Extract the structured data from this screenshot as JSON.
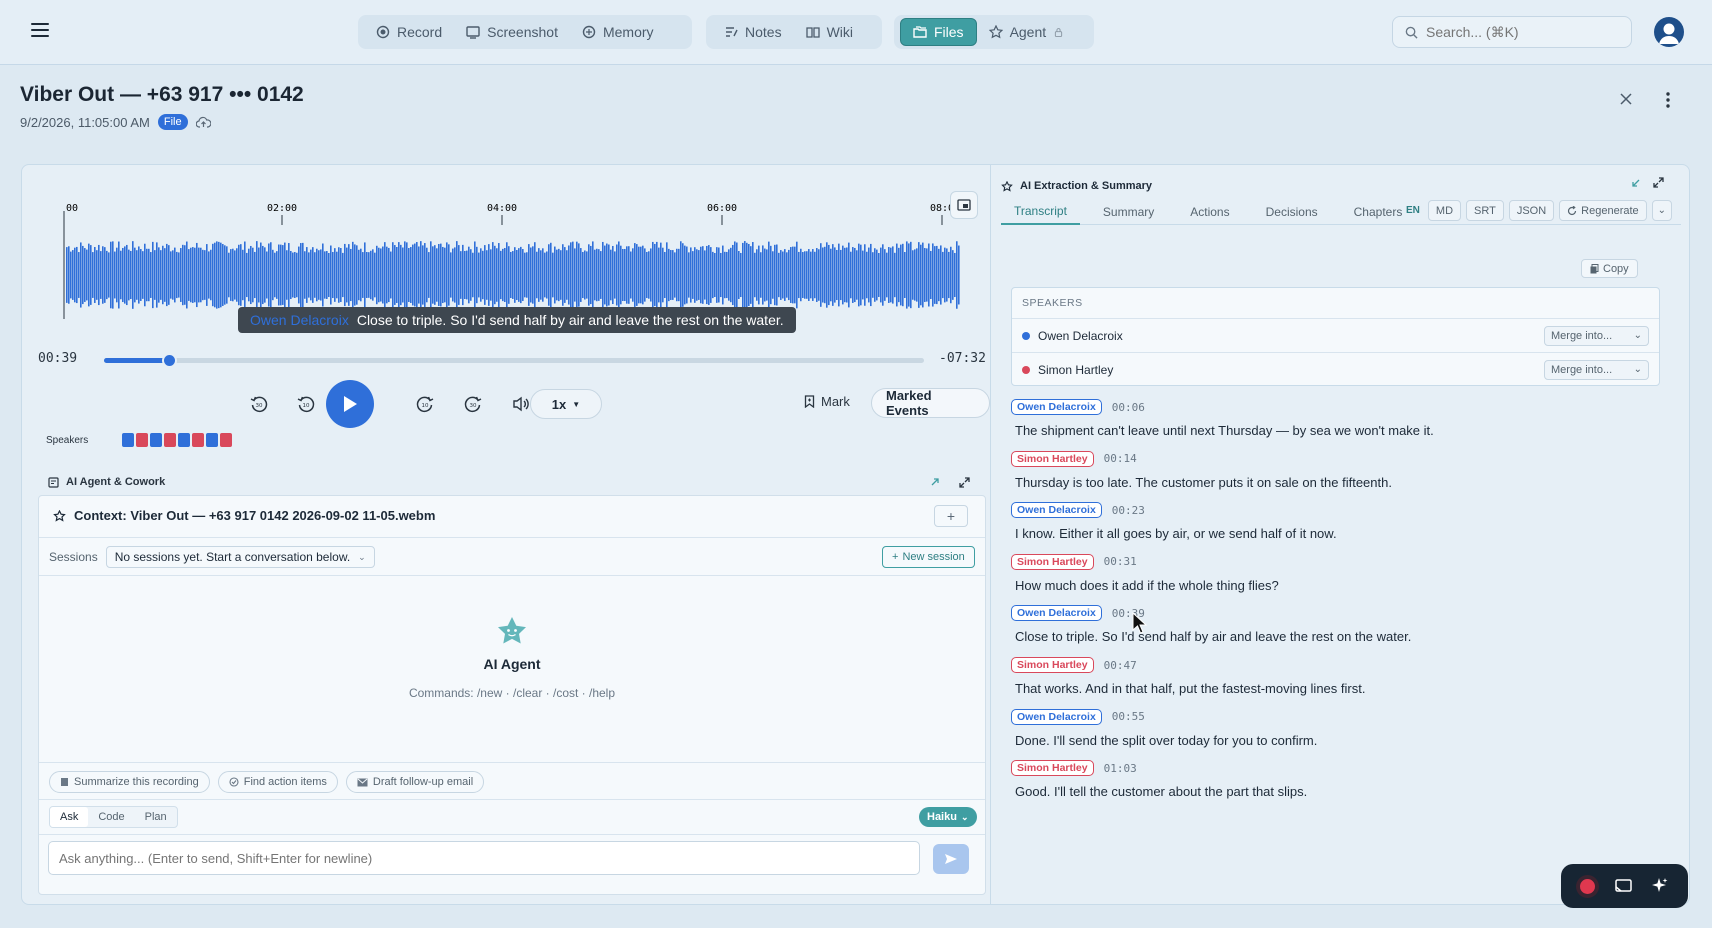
{
  "nav": {
    "groups": [
      [
        {
          "label": "Record",
          "icon": "record-icon"
        },
        {
          "label": "Screenshot",
          "icon": "screenshot-icon"
        },
        {
          "label": "Memory",
          "icon": "memory-icon"
        }
      ],
      [
        {
          "label": "Notes",
          "icon": "notes-icon"
        },
        {
          "label": "Wiki",
          "icon": "wiki-icon"
        }
      ],
      [
        {
          "label": "Files",
          "icon": "files-icon",
          "active": true
        },
        {
          "label": "Agent",
          "icon": "agent-icon"
        }
      ]
    ],
    "search_placeholder": "Search... (⌘K)"
  },
  "header": {
    "title": "Viber Out — +63 917 ••• 0142",
    "datetime": "9/2/2026, 11:05:00 AM",
    "badge": "File"
  },
  "player": {
    "ticks": [
      "00",
      "02:00",
      "04:00",
      "06:00",
      "08:0"
    ],
    "tooltip_speaker": "Owen Delacroix",
    "tooltip_text": "Close to triple. So I'd send half by air and leave the rest on the water.",
    "elapsed": "00:39",
    "remaining": "-07:32",
    "progress": 0.0794,
    "speed": "1x",
    "mark_label": "Mark",
    "marked_events_label": "Marked Events",
    "speakers_label": "Speakers",
    "speaker_squares": [
      "#2f6fd9",
      "#d9485b",
      "#2f6fd9",
      "#d9485b",
      "#2f6fd9",
      "#d9485b",
      "#2f6fd9",
      "#d9485b"
    ],
    "waveform_color": "#2f6fd9"
  },
  "agent": {
    "header": "AI Agent & Cowork",
    "context": "Context: Viber Out — +63 917 0142 2026-09-02 11-05.webm",
    "plus": "+",
    "sessions_label": "Sessions",
    "sessions_value": "No sessions yet. Start a conversation below.",
    "new_session": "New session",
    "name": "AI Agent",
    "commands": "Commands: /new · /clear · /cost · /help",
    "chips": [
      "Summarize this recording",
      "Find action items",
      "Draft follow-up email"
    ],
    "modes": [
      "Ask",
      "Code",
      "Plan"
    ],
    "active_mode": "Ask",
    "model": "Haiku",
    "input_placeholder": "Ask anything... (Enter to send, Shift+Enter for newline)"
  },
  "extraction": {
    "title": "AI Extraction & Summary",
    "tabs": [
      "Transcript",
      "Summary",
      "Actions",
      "Decisions",
      "Chapters"
    ],
    "active_tab": "Transcript",
    "lang": "EN",
    "formats": [
      "MD",
      "SRT",
      "JSON"
    ],
    "regenerate": "Regenerate",
    "copy": "Copy",
    "speakers_heading": "SPEAKERS",
    "speakers": [
      {
        "name": "Owen Delacroix",
        "color": "#2f6fd9",
        "merge": "Merge into..."
      },
      {
        "name": "Simon Hartley",
        "color": "#d9485b",
        "merge": "Merge into..."
      }
    ],
    "segments": [
      {
        "speaker": "Owen Delacroix",
        "time": "00:06",
        "text": "The shipment can't leave until next Thursday — by sea we won't make it."
      },
      {
        "speaker": "Simon Hartley",
        "time": "00:14",
        "text": "Thursday is too late. The customer puts it on sale on the fifteenth."
      },
      {
        "speaker": "Owen Delacroix",
        "time": "00:23",
        "text": "I know. Either it all goes by air, or we send half of it now."
      },
      {
        "speaker": "Simon Hartley",
        "time": "00:31",
        "text": "How much does it add if the whole thing flies?"
      },
      {
        "speaker": "Owen Delacroix",
        "time": "00:39",
        "text": "Close to triple. So I'd send half by air and leave the rest on the water."
      },
      {
        "speaker": "Simon Hartley",
        "time": "00:47",
        "text": "That works. And in that half, put the fastest-moving lines first."
      },
      {
        "speaker": "Owen Delacroix",
        "time": "00:55",
        "text": "Done. I'll send the split over today for you to confirm."
      },
      {
        "speaker": "Simon Hartley",
        "time": "01:03",
        "text": "Good. I'll tell the customer about the part that slips."
      }
    ]
  }
}
